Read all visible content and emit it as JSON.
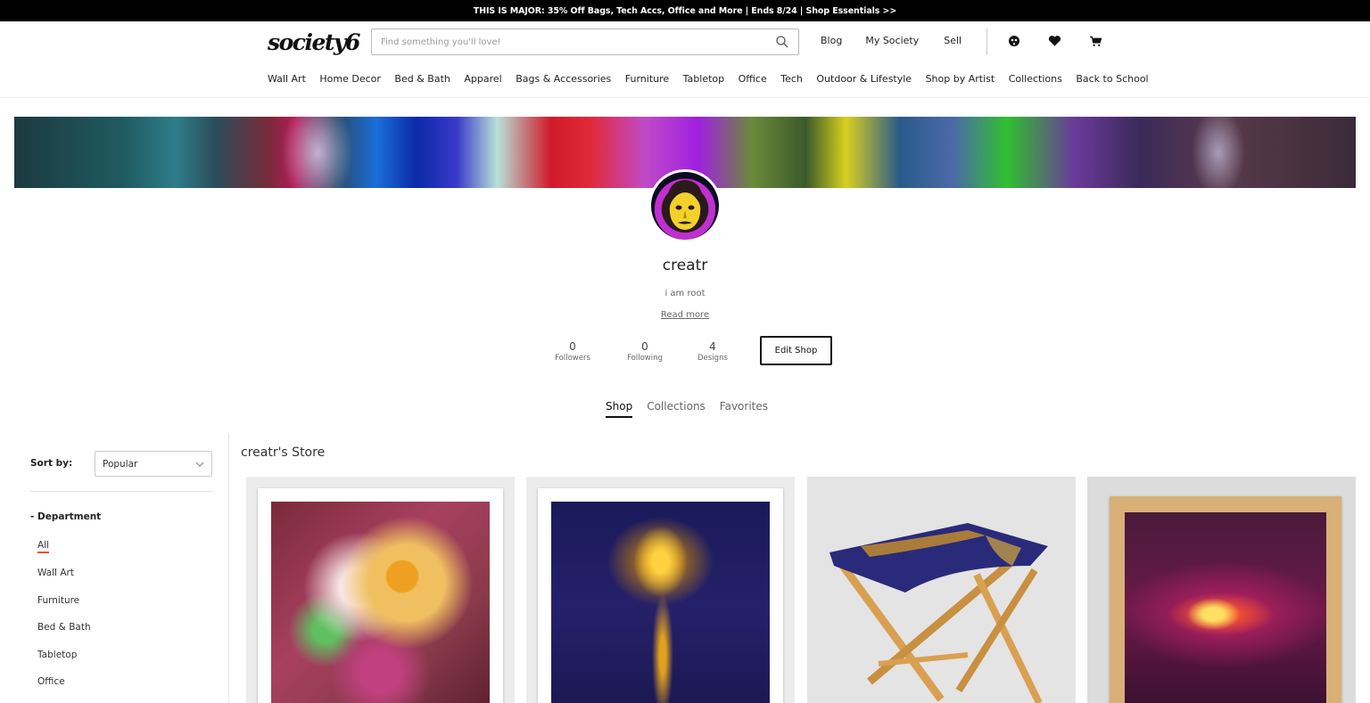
{
  "promo": "THIS IS MAJOR: 35% Off Bags, Tech Accs, Office and More | Ends 8/24 | Shop Essentials >>",
  "header": {
    "logo": "society6",
    "search_placeholder": "Find something you'll love!",
    "links": [
      "Blog",
      "My Society",
      "Sell"
    ],
    "icons": [
      "account-icon",
      "heart-icon",
      "cart-icon"
    ]
  },
  "nav": [
    "Wall Art",
    "Home Decor",
    "Bed & Bath",
    "Apparel",
    "Bags & Accessories",
    "Furniture",
    "Tabletop",
    "Office",
    "Tech",
    "Outdoor & Lifestyle",
    "Shop by Artist",
    "Collections",
    "Back to School"
  ],
  "profile": {
    "username": "creatr",
    "tagline": "i am root",
    "read_more": "Read more",
    "stats": [
      {
        "value": "0",
        "label": "Followers"
      },
      {
        "value": "0",
        "label": "Following"
      },
      {
        "value": "4",
        "label": "Designs"
      }
    ],
    "edit_button": "Edit Shop"
  },
  "tabs": [
    {
      "label": "Shop",
      "active": true
    },
    {
      "label": "Collections",
      "active": false
    },
    {
      "label": "Favorites",
      "active": false
    }
  ],
  "sidebar": {
    "sort_label": "Sort by:",
    "sort_value": "Popular",
    "department_title": "- Department",
    "departments": [
      "All",
      "Wall Art",
      "Furniture",
      "Bed & Bath",
      "Tabletop",
      "Office"
    ]
  },
  "store": {
    "title": "creatr's Store"
  },
  "colors": {
    "accent": "#e8562a",
    "promo_bg": "#000000"
  }
}
